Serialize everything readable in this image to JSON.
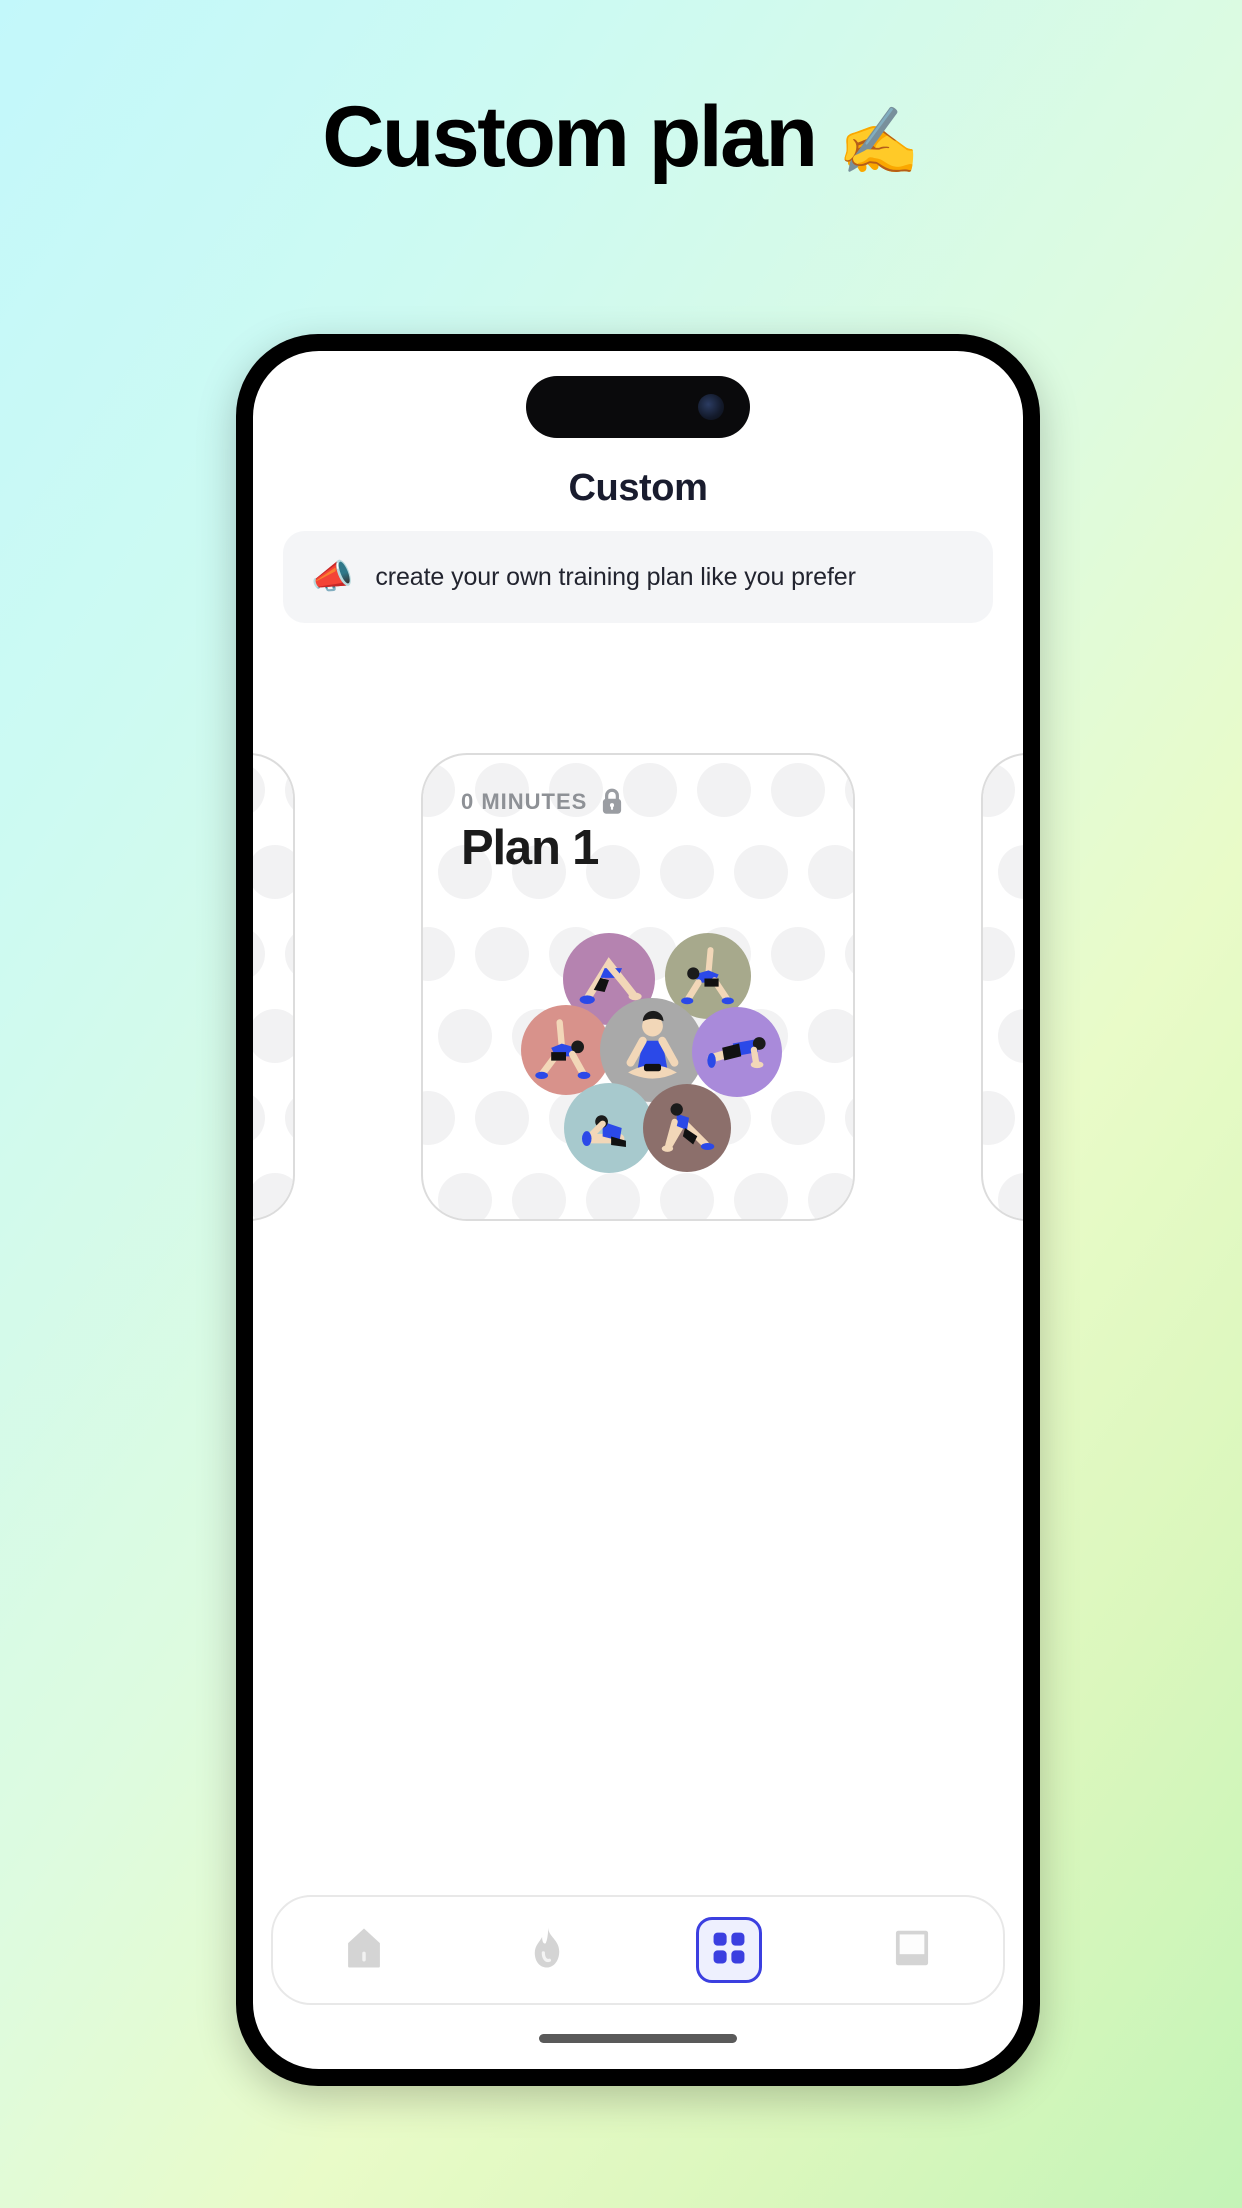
{
  "page": {
    "title": "Custom plan",
    "title_emoji": "✍️",
    "title_emoji_name": "writing-hand-emoji",
    "background_colors": [
      "#c3f8fb",
      "#e9fbc8",
      "#c3f4b7"
    ]
  },
  "phone": {
    "status": {
      "dynamic_island": "dynamic-island",
      "camera": "front-camera-lens"
    }
  },
  "screen": {
    "header_title": "Custom",
    "banner": {
      "emoji": "📣",
      "emoji_name": "megaphone-icon",
      "text": "create your own training plan like you prefer",
      "background": "#f4f5f7"
    },
    "carousel": {
      "cards": [
        {
          "duration_label": "0 MINUTES",
          "locked": true,
          "lock_icon": "lock-icon",
          "name": "Plan 1",
          "exercises": [
            {
              "name": "downward-dog",
              "color": "#b583b0"
            },
            {
              "name": "standing-side-reach",
              "color": "#a7a98c"
            },
            {
              "name": "triangle-stretch",
              "color": "#d8928b"
            },
            {
              "name": "seated-lotus",
              "color": "#a9a9a9"
            },
            {
              "name": "plank",
              "color": "#a98ada"
            },
            {
              "name": "seated-forward-fold",
              "color": "#a7c9cd"
            },
            {
              "name": "cobra-stretch",
              "color": "#8c6f6b"
            }
          ]
        }
      ]
    },
    "tabbar": {
      "items": [
        {
          "name": "tab-home",
          "icon": "home-icon",
          "active": false
        },
        {
          "name": "tab-workout",
          "icon": "flame-icon",
          "active": false
        },
        {
          "name": "tab-plans",
          "icon": "grid-icon",
          "active": true
        },
        {
          "name": "tab-profile",
          "icon": "window-icon",
          "active": false
        }
      ],
      "active_color": "#3b3fe0",
      "inactive_color": "#d3d3d3"
    },
    "home_indicator": "home-indicator"
  }
}
